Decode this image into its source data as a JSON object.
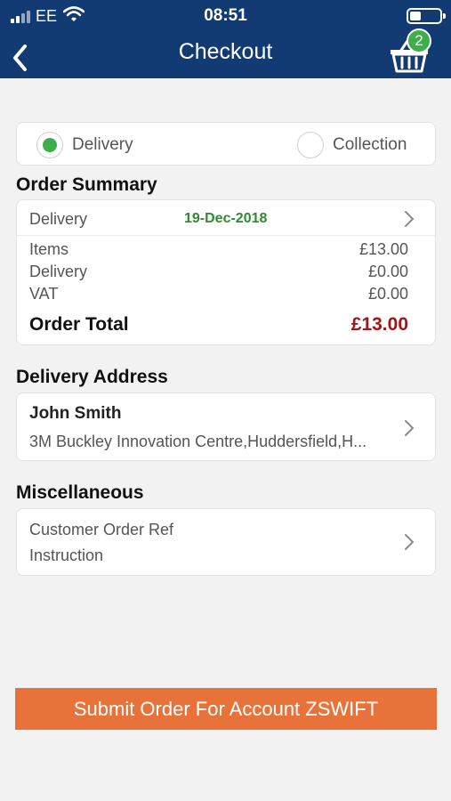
{
  "status_bar": {
    "carrier": "EE",
    "time": "08:51"
  },
  "header": {
    "title": "Checkout",
    "cart_count": "2",
    "back_icon": "chevron-left-icon",
    "basket_icon": "shopping-basket-icon"
  },
  "fulfilment": {
    "options": [
      "Delivery",
      "Collection"
    ],
    "selected": "Delivery"
  },
  "order_summary": {
    "title": "Order Summary",
    "delivery_label": "Delivery",
    "delivery_date": "19-Dec-2018",
    "lines": [
      {
        "label": "Items",
        "value": "£13.00"
      },
      {
        "label": "Delivery",
        "value": "£0.00"
      },
      {
        "label": "VAT",
        "value": "£0.00"
      }
    ],
    "total_label": "Order Total",
    "total_value": "£13.00"
  },
  "delivery_address": {
    "title": "Delivery Address",
    "name": "John Smith",
    "address": "3M Buckley Innovation Centre,Huddersfield,H..."
  },
  "miscellaneous": {
    "title": "Miscellaneous",
    "fields": [
      "Customer Order Ref",
      "Instruction"
    ]
  },
  "submit_label": "Submit Order For Account ZSWIFT",
  "colors": {
    "header": "#123a73",
    "accent_green": "#3cae4a",
    "date_green": "#2e8b32",
    "total_red": "#a31515",
    "submit": "#e8733a"
  }
}
